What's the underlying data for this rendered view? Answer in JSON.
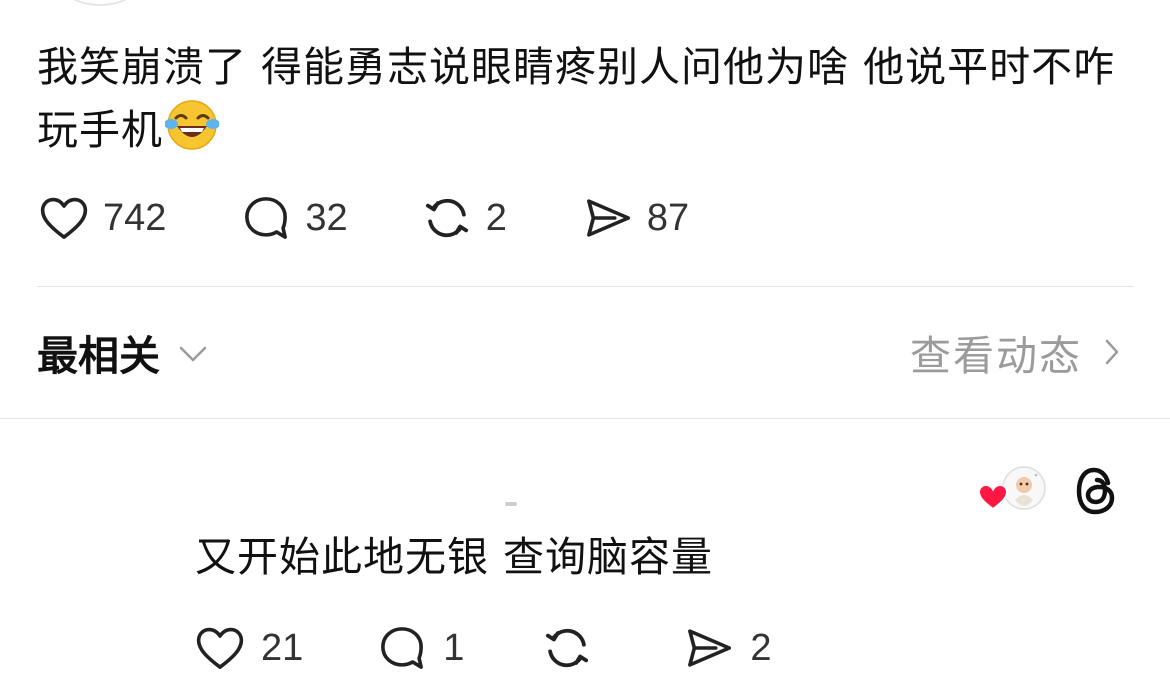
{
  "post": {
    "text": "我笑崩溃了 得能勇志说眼睛疼别人问他为啥 他说平时不咋玩手机",
    "emoji": "face-with-tears-of-joy",
    "likes": "742",
    "replies": "32",
    "reposts": "2",
    "shares": "87"
  },
  "sort": {
    "label": "最相关",
    "activity_label": "查看动态"
  },
  "reply": {
    "text": "又开始此地无银 查询脑容量",
    "likes": "21",
    "replies": "1",
    "reposts": "",
    "shares": "2"
  },
  "colors": {
    "text": "#111111",
    "muted": "#9b9b9b",
    "divider": "#e3e3e3",
    "like_heart": "#ff1744",
    "icon_stroke": "#222222"
  },
  "icons": [
    "heart-icon",
    "comment-icon",
    "repost-icon",
    "share-icon",
    "chevron-down-icon",
    "chevron-right-icon",
    "threads-icon"
  ]
}
